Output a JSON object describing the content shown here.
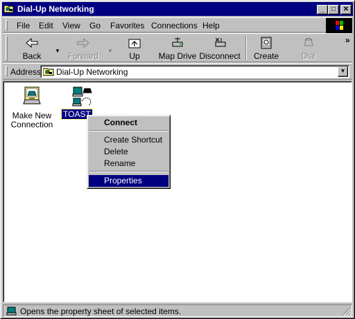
{
  "window": {
    "title": "Dial-Up Networking",
    "title_icon": "folder-network-icon",
    "controls": {
      "minimize": "_",
      "maximize": "□",
      "close": "✕"
    }
  },
  "menubar": {
    "items": [
      {
        "label": "File"
      },
      {
        "label": "Edit"
      },
      {
        "label": "View"
      },
      {
        "label": "Go"
      },
      {
        "label": "Favorites"
      },
      {
        "label": "Connections"
      },
      {
        "label": "Help"
      }
    ],
    "logo_icon": "windows-logo-icon"
  },
  "toolbar": {
    "buttons": [
      {
        "label": "Back",
        "icon": "back-arrow-icon",
        "disabled": false
      },
      {
        "label": "Forward",
        "icon": "forward-arrow-icon",
        "disabled": true
      },
      {
        "label": "Up",
        "icon": "up-folder-icon",
        "disabled": false
      },
      {
        "label": "Map Drive",
        "icon": "map-drive-icon",
        "disabled": false
      },
      {
        "label": "Disconnect",
        "icon": "disconnect-icon",
        "disabled": false
      },
      {
        "label": "Create",
        "icon": "create-icon",
        "disabled": false
      },
      {
        "label": "Dial",
        "icon": "dial-phone-icon",
        "disabled": true
      }
    ],
    "more_glyph": "»"
  },
  "address": {
    "label": "Address",
    "value": "Dial-Up Networking",
    "icon": "folder-network-icon"
  },
  "items": [
    {
      "label_line1": "Make New",
      "label_line2": "Connection",
      "icon": "make-new-connection-icon",
      "selected": false
    },
    {
      "label_line1": "TOAST",
      "label_line2": "",
      "icon": "connection-computer-icon",
      "selected": true
    }
  ],
  "context_menu": {
    "items": [
      {
        "label": "Connect",
        "bold": true
      },
      {
        "label": "Create Shortcut"
      },
      {
        "label": "Delete"
      },
      {
        "label": "Rename"
      },
      {
        "label": "Properties",
        "highlighted": true
      }
    ]
  },
  "status": {
    "text": "Opens the property sheet of selected items.",
    "icon": "computer-status-icon"
  },
  "colors": {
    "face": "#c0c0c0",
    "titlebar": "#000080",
    "selection": "#000080",
    "window_bg": "#ffffff"
  }
}
